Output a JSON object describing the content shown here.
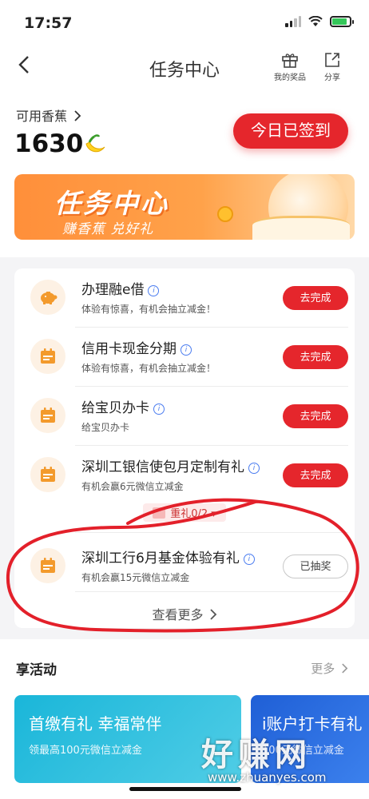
{
  "status_bar": {
    "time": "17:57"
  },
  "nav": {
    "title": "任务中心",
    "my_prizes_label": "我的奖品",
    "share_label": "分享"
  },
  "header": {
    "banana_label": "可用香蕉",
    "banana_count": "1630",
    "signin_label": "今日已签到"
  },
  "banner": {
    "title": "任务中心",
    "subtitle": "赚香蕉 兑好礼"
  },
  "tasks": [
    {
      "title": "办理融e借",
      "subtitle": "体验有惊喜，有机会抽立减金！",
      "button": "去完成",
      "icon": "piggy-bank-icon",
      "done": false
    },
    {
      "title": "信用卡现金分期",
      "subtitle": "体验有惊喜，有机会抽立减金！",
      "button": "去完成",
      "icon": "calendar-icon",
      "done": false
    },
    {
      "title": "给宝贝办卡",
      "subtitle": "给宝贝办卡",
      "button": "去完成",
      "icon": "calendar-icon",
      "done": false
    },
    {
      "title": "深圳工银信使包月定制有礼",
      "subtitle": "有机会赢6元微信立减金",
      "button": "去完成",
      "icon": "calendar-icon",
      "done": false
    },
    {
      "title": "深圳工行6月基金体验有礼",
      "subtitle": "有机会赢15元微信立减金",
      "button": "已抽奖",
      "icon": "calendar-icon",
      "done": true
    }
  ],
  "reward_progress": "重礼0/2",
  "see_more": "查看更多",
  "activities": {
    "title": "享活动",
    "more": "更多",
    "cards": [
      {
        "title": "首缴有礼 幸福常伴",
        "subtitle": "领最高100元微信立减金"
      },
      {
        "title": "i账户打卡有礼",
        "subtitle": "100元微信立减金"
      }
    ]
  },
  "watermark": {
    "text": "好赚网",
    "url": "www.zhuanyes.com"
  },
  "colors": {
    "accent": "#e5262c",
    "banner_orange": "#ff8f3a",
    "icon_orange": "#f39a2c",
    "info_blue": "#4a7cf0"
  }
}
